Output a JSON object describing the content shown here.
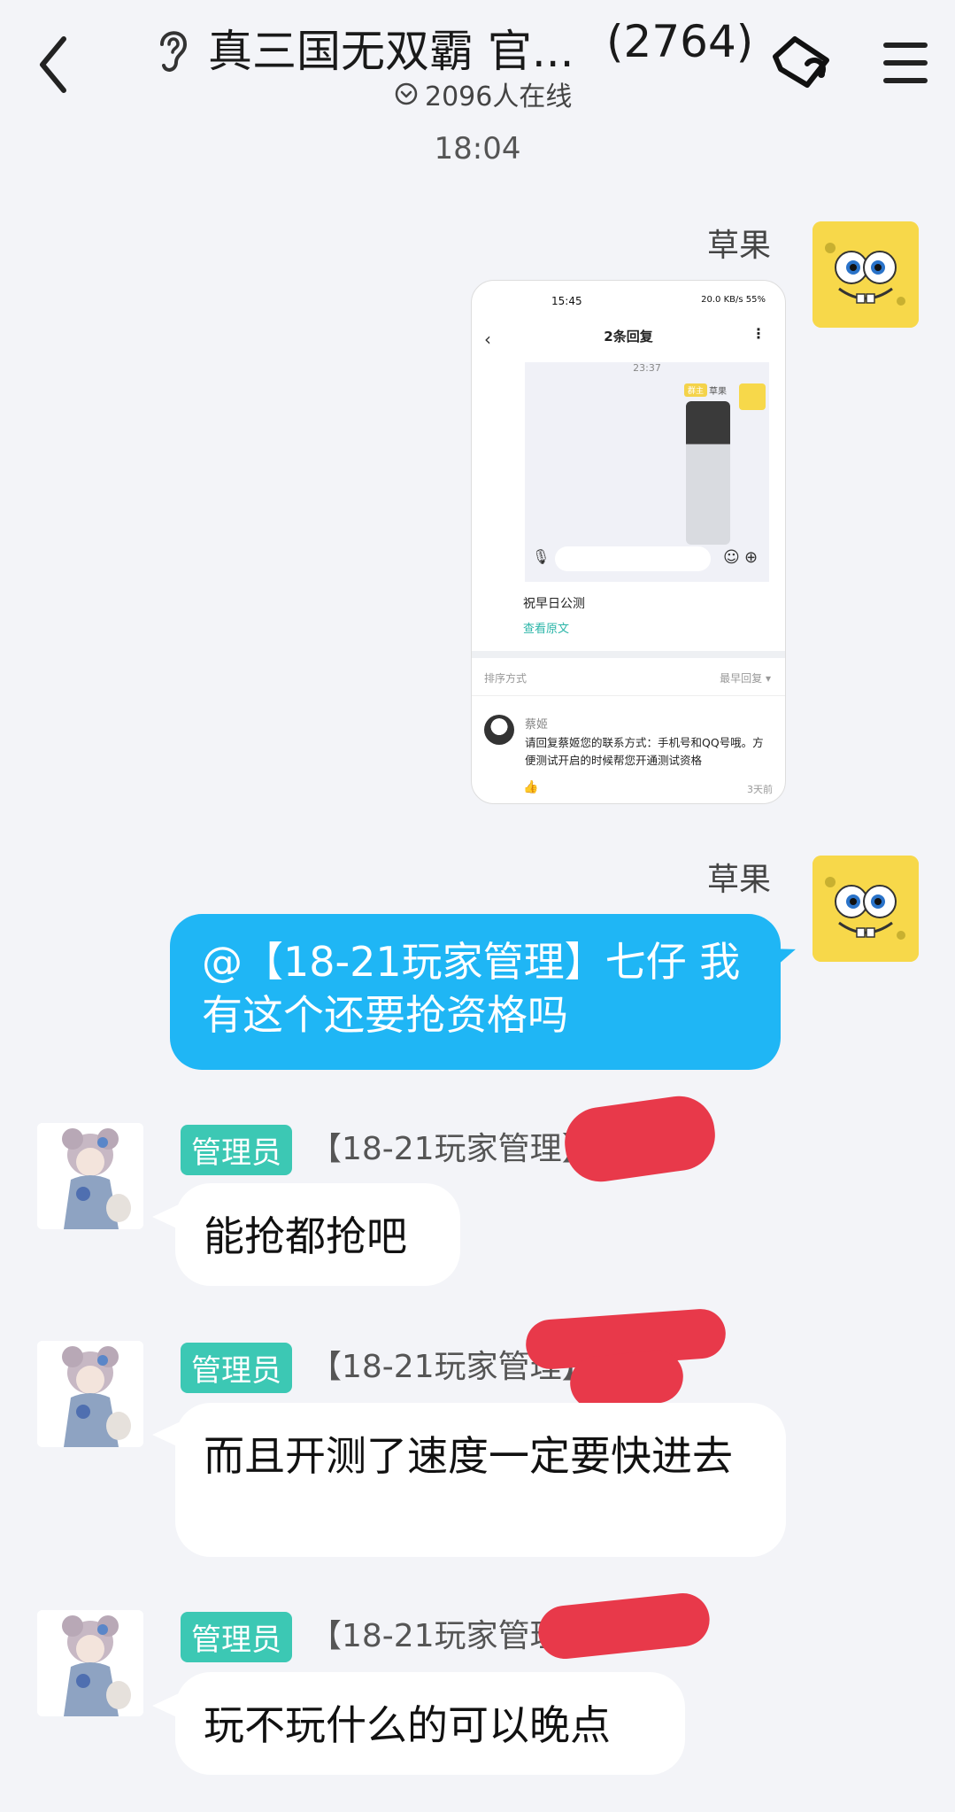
{
  "header": {
    "title": "真三国无双霸 官...",
    "member_count": "(2764)",
    "online": "2096人在线"
  },
  "time_separator": "18:04",
  "messages": [
    {
      "sender": "草果",
      "type": "image",
      "screenshot": {
        "status_time": "15:45",
        "status_right": "20.0 KB/s  55%",
        "title": "2条回复",
        "inner_time": "23:37",
        "inner_badge": "群主",
        "inner_name": "草果",
        "wish": "祝早日公测",
        "view_original": "查看原文",
        "sort_label": "排序方式",
        "sort_value": "最早回复 ▾",
        "commenter": "蔡姬",
        "comment": "请回复蔡姬您的联系方式：手机号和QQ号哦。方便测试开启的时候帮您开通测试资格",
        "ago": "3天前"
      }
    },
    {
      "sender": "草果",
      "type": "text",
      "text": "@【18-21玩家管理】七仔 我有这个还要抢资格吗"
    }
  ],
  "replies": [
    {
      "role": "管理员",
      "name": "【18-21玩家管理】",
      "text": "能抢都抢吧"
    },
    {
      "role": "管理员",
      "name": "【18-21玩家管理】",
      "text": "而且开测了速度一定要快进去"
    },
    {
      "role": "管理员",
      "name": "【18-21玩家管理",
      "text": "玩不玩什么的可以晚点"
    }
  ],
  "colors": {
    "accent_blue": "#1fb6f5",
    "admin_badge": "#3cc8b4",
    "redaction": "#e8394a",
    "background": "#f3f4f8"
  },
  "icons": [
    "back-icon",
    "ear-icon",
    "tag-icon",
    "menu-icon",
    "chevron-circle-icon"
  ]
}
